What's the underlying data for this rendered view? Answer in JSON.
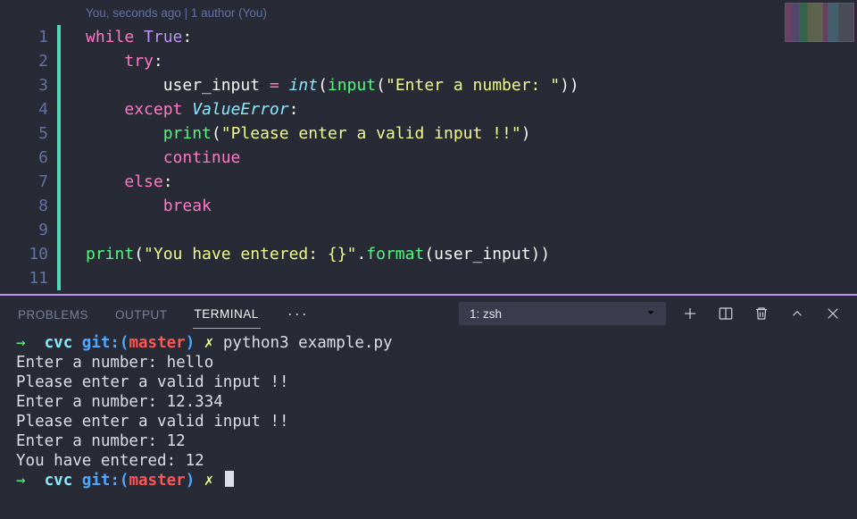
{
  "editor": {
    "codelens": "You, seconds ago | 1 author (You)",
    "line_numbers": [
      "1",
      "2",
      "3",
      "4",
      "5",
      "6",
      "7",
      "8",
      "9",
      "10",
      "11"
    ],
    "code": {
      "l1": {
        "while": "while",
        "true": "True",
        "colon": ":"
      },
      "l2": {
        "try": "try",
        "colon": ":"
      },
      "l3": {
        "id": "user_input",
        "eq": " = ",
        "int": "int",
        "lp1": "(",
        "input": "input",
        "lp2": "(",
        "str": "\"Enter a number: \"",
        "rp": "))"
      },
      "l4": {
        "except": "except",
        "exc": "ValueError",
        "colon": ":"
      },
      "l5": {
        "print": "print",
        "lp": "(",
        "str": "\"Please enter a valid input !!\"",
        "rp": ")"
      },
      "l6": {
        "continue": "continue"
      },
      "l7": {
        "else": "else",
        "colon": ":"
      },
      "l8": {
        "break": "break"
      },
      "l10": {
        "print": "print",
        "lp": "(",
        "str": "\"You have entered: {}\"",
        "dot": ".",
        "format": "format",
        "lp2": "(",
        "id": "user_input",
        "rp": "))"
      }
    }
  },
  "panel": {
    "tabs": {
      "problems": "PROBLEMS",
      "output": "OUTPUT",
      "terminal": "TERMINAL"
    },
    "more": "···",
    "picker": {
      "label": "1: zsh"
    }
  },
  "terminal": {
    "prompt": {
      "arrow": "→",
      "cwd": "cvc",
      "git_label": "git:(",
      "branch": "master",
      "git_close": ")",
      "dirty": "✗"
    },
    "cmd1": "python3 example.py",
    "out": [
      "Enter a number: hello",
      "Please enter a valid input !!",
      "Enter a number: 12.334",
      "Please enter a valid input !!",
      "Enter a number: 12",
      "You have entered: 12"
    ]
  }
}
